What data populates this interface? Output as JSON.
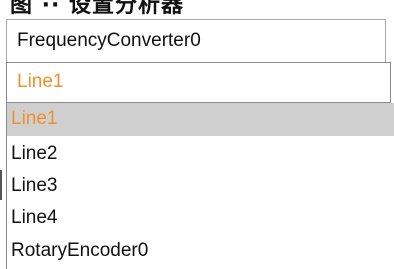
{
  "top_partial_text": "图 ·· 设置分析器",
  "header": {
    "label": "FrequencyConverter0"
  },
  "combo": {
    "selected_value": "Line1"
  },
  "dropdown": {
    "items": [
      {
        "label": "Line1",
        "selected": true
      },
      {
        "label": "Line2",
        "selected": false
      },
      {
        "label": "Line3",
        "selected": false
      },
      {
        "label": "Line4",
        "selected": false
      },
      {
        "label": "RotaryEncoder0",
        "selected": false
      }
    ]
  },
  "colors": {
    "selected_text": "#f0902a",
    "selected_background": "#cfcfcf",
    "border": "#8a8a8a"
  }
}
